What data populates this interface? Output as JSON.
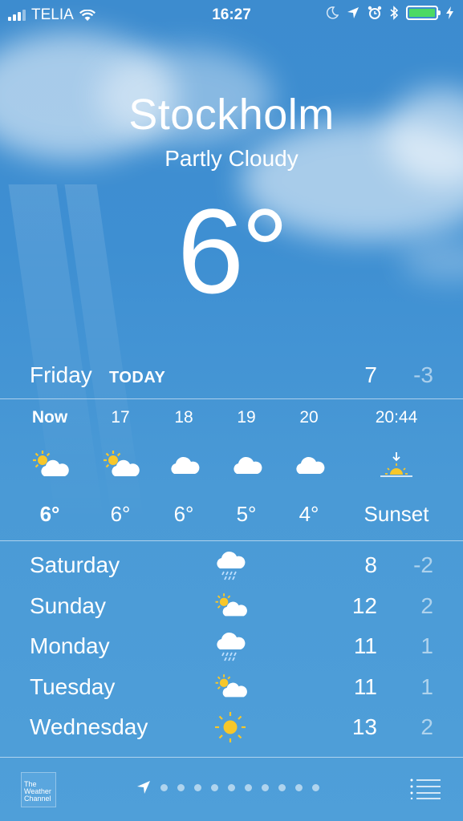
{
  "status_bar": {
    "carrier": "TELIA",
    "time": "16:27",
    "battery_color": "#4cd964"
  },
  "location": {
    "city": "Stockholm",
    "condition": "Partly Cloudy",
    "current_temp": "6°"
  },
  "today": {
    "day": "Friday",
    "tag": "TODAY",
    "high": "7",
    "low": "-3"
  },
  "hourly": [
    {
      "label": "Now",
      "icon": "partly-cloudy-day-icon",
      "temp": "6°"
    },
    {
      "label": "17",
      "icon": "partly-cloudy-day-icon",
      "temp": "6°"
    },
    {
      "label": "18",
      "icon": "cloud-icon",
      "temp": "6°"
    },
    {
      "label": "19",
      "icon": "cloud-icon",
      "temp": "5°"
    },
    {
      "label": "20",
      "icon": "cloud-icon",
      "temp": "4°"
    },
    {
      "label": "20:44",
      "icon": "sunset-icon",
      "temp": "Sunset"
    }
  ],
  "daily": [
    {
      "day": "Saturday",
      "icon": "rain-cloud-icon",
      "high": "8",
      "low": "-2"
    },
    {
      "day": "Sunday",
      "icon": "partly-cloudy-day-icon",
      "high": "12",
      "low": "2"
    },
    {
      "day": "Monday",
      "icon": "rain-cloud-icon",
      "high": "11",
      "low": "1"
    },
    {
      "day": "Tuesday",
      "icon": "partly-cloudy-day-icon",
      "high": "11",
      "low": "1"
    },
    {
      "day": "Wednesday",
      "icon": "sun-icon",
      "high": "13",
      "low": "2"
    }
  ],
  "bottom_bar": {
    "provider_logo_text": "The Weather Channel",
    "page_count": 11,
    "current_page": 0
  }
}
